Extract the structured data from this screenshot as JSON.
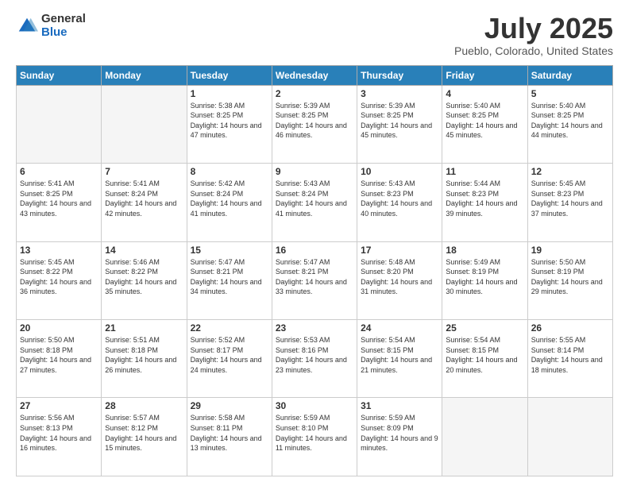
{
  "logo": {
    "general": "General",
    "blue": "Blue"
  },
  "title": "July 2025",
  "subtitle": "Pueblo, Colorado, United States",
  "days_header": [
    "Sunday",
    "Monday",
    "Tuesday",
    "Wednesday",
    "Thursday",
    "Friday",
    "Saturday"
  ],
  "weeks": [
    [
      {
        "day": "",
        "empty": true
      },
      {
        "day": "",
        "empty": true
      },
      {
        "day": "1",
        "sunrise": "Sunrise: 5:38 AM",
        "sunset": "Sunset: 8:25 PM",
        "daylight": "Daylight: 14 hours and 47 minutes."
      },
      {
        "day": "2",
        "sunrise": "Sunrise: 5:39 AM",
        "sunset": "Sunset: 8:25 PM",
        "daylight": "Daylight: 14 hours and 46 minutes."
      },
      {
        "day": "3",
        "sunrise": "Sunrise: 5:39 AM",
        "sunset": "Sunset: 8:25 PM",
        "daylight": "Daylight: 14 hours and 45 minutes."
      },
      {
        "day": "4",
        "sunrise": "Sunrise: 5:40 AM",
        "sunset": "Sunset: 8:25 PM",
        "daylight": "Daylight: 14 hours and 45 minutes."
      },
      {
        "day": "5",
        "sunrise": "Sunrise: 5:40 AM",
        "sunset": "Sunset: 8:25 PM",
        "daylight": "Daylight: 14 hours and 44 minutes."
      }
    ],
    [
      {
        "day": "6",
        "sunrise": "Sunrise: 5:41 AM",
        "sunset": "Sunset: 8:25 PM",
        "daylight": "Daylight: 14 hours and 43 minutes."
      },
      {
        "day": "7",
        "sunrise": "Sunrise: 5:41 AM",
        "sunset": "Sunset: 8:24 PM",
        "daylight": "Daylight: 14 hours and 42 minutes."
      },
      {
        "day": "8",
        "sunrise": "Sunrise: 5:42 AM",
        "sunset": "Sunset: 8:24 PM",
        "daylight": "Daylight: 14 hours and 41 minutes."
      },
      {
        "day": "9",
        "sunrise": "Sunrise: 5:43 AM",
        "sunset": "Sunset: 8:24 PM",
        "daylight": "Daylight: 14 hours and 41 minutes."
      },
      {
        "day": "10",
        "sunrise": "Sunrise: 5:43 AM",
        "sunset": "Sunset: 8:23 PM",
        "daylight": "Daylight: 14 hours and 40 minutes."
      },
      {
        "day": "11",
        "sunrise": "Sunrise: 5:44 AM",
        "sunset": "Sunset: 8:23 PM",
        "daylight": "Daylight: 14 hours and 39 minutes."
      },
      {
        "day": "12",
        "sunrise": "Sunrise: 5:45 AM",
        "sunset": "Sunset: 8:23 PM",
        "daylight": "Daylight: 14 hours and 37 minutes."
      }
    ],
    [
      {
        "day": "13",
        "sunrise": "Sunrise: 5:45 AM",
        "sunset": "Sunset: 8:22 PM",
        "daylight": "Daylight: 14 hours and 36 minutes."
      },
      {
        "day": "14",
        "sunrise": "Sunrise: 5:46 AM",
        "sunset": "Sunset: 8:22 PM",
        "daylight": "Daylight: 14 hours and 35 minutes."
      },
      {
        "day": "15",
        "sunrise": "Sunrise: 5:47 AM",
        "sunset": "Sunset: 8:21 PM",
        "daylight": "Daylight: 14 hours and 34 minutes."
      },
      {
        "day": "16",
        "sunrise": "Sunrise: 5:47 AM",
        "sunset": "Sunset: 8:21 PM",
        "daylight": "Daylight: 14 hours and 33 minutes."
      },
      {
        "day": "17",
        "sunrise": "Sunrise: 5:48 AM",
        "sunset": "Sunset: 8:20 PM",
        "daylight": "Daylight: 14 hours and 31 minutes."
      },
      {
        "day": "18",
        "sunrise": "Sunrise: 5:49 AM",
        "sunset": "Sunset: 8:19 PM",
        "daylight": "Daylight: 14 hours and 30 minutes."
      },
      {
        "day": "19",
        "sunrise": "Sunrise: 5:50 AM",
        "sunset": "Sunset: 8:19 PM",
        "daylight": "Daylight: 14 hours and 29 minutes."
      }
    ],
    [
      {
        "day": "20",
        "sunrise": "Sunrise: 5:50 AM",
        "sunset": "Sunset: 8:18 PM",
        "daylight": "Daylight: 14 hours and 27 minutes."
      },
      {
        "day": "21",
        "sunrise": "Sunrise: 5:51 AM",
        "sunset": "Sunset: 8:18 PM",
        "daylight": "Daylight: 14 hours and 26 minutes."
      },
      {
        "day": "22",
        "sunrise": "Sunrise: 5:52 AM",
        "sunset": "Sunset: 8:17 PM",
        "daylight": "Daylight: 14 hours and 24 minutes."
      },
      {
        "day": "23",
        "sunrise": "Sunrise: 5:53 AM",
        "sunset": "Sunset: 8:16 PM",
        "daylight": "Daylight: 14 hours and 23 minutes."
      },
      {
        "day": "24",
        "sunrise": "Sunrise: 5:54 AM",
        "sunset": "Sunset: 8:15 PM",
        "daylight": "Daylight: 14 hours and 21 minutes."
      },
      {
        "day": "25",
        "sunrise": "Sunrise: 5:54 AM",
        "sunset": "Sunset: 8:15 PM",
        "daylight": "Daylight: 14 hours and 20 minutes."
      },
      {
        "day": "26",
        "sunrise": "Sunrise: 5:55 AM",
        "sunset": "Sunset: 8:14 PM",
        "daylight": "Daylight: 14 hours and 18 minutes."
      }
    ],
    [
      {
        "day": "27",
        "sunrise": "Sunrise: 5:56 AM",
        "sunset": "Sunset: 8:13 PM",
        "daylight": "Daylight: 14 hours and 16 minutes."
      },
      {
        "day": "28",
        "sunrise": "Sunrise: 5:57 AM",
        "sunset": "Sunset: 8:12 PM",
        "daylight": "Daylight: 14 hours and 15 minutes."
      },
      {
        "day": "29",
        "sunrise": "Sunrise: 5:58 AM",
        "sunset": "Sunset: 8:11 PM",
        "daylight": "Daylight: 14 hours and 13 minutes."
      },
      {
        "day": "30",
        "sunrise": "Sunrise: 5:59 AM",
        "sunset": "Sunset: 8:10 PM",
        "daylight": "Daylight: 14 hours and 11 minutes."
      },
      {
        "day": "31",
        "sunrise": "Sunrise: 5:59 AM",
        "sunset": "Sunset: 8:09 PM",
        "daylight": "Daylight: 14 hours and 9 minutes."
      },
      {
        "day": "",
        "empty": true
      },
      {
        "day": "",
        "empty": true
      }
    ]
  ]
}
